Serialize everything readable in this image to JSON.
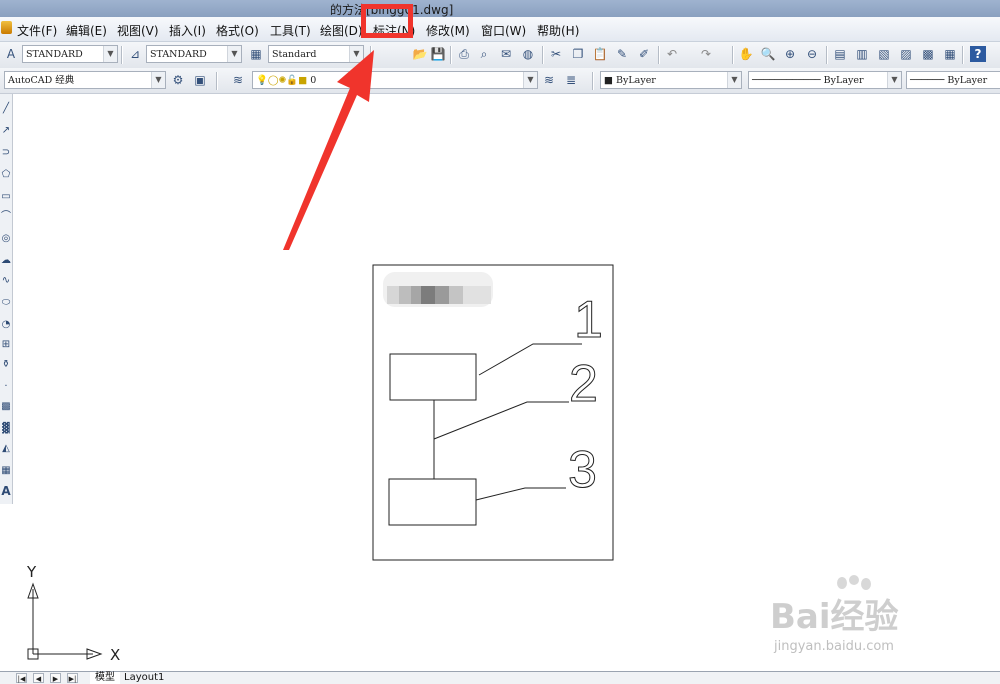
{
  "window": {
    "title": "的方法[blngg01.dwg]"
  },
  "menu": {
    "items": [
      {
        "id": "file",
        "label": "文件(F)"
      },
      {
        "id": "edit",
        "label": "编辑(E)"
      },
      {
        "id": "view",
        "label": "视图(V)"
      },
      {
        "id": "insert",
        "label": "插入(I)"
      },
      {
        "id": "format",
        "label": "格式(O)"
      },
      {
        "id": "tools",
        "label": "工具(T)"
      },
      {
        "id": "draw",
        "label": "绘图(D)"
      },
      {
        "id": "dimension",
        "label": "标注(N)"
      },
      {
        "id": "modify",
        "label": "修改(M)"
      },
      {
        "id": "window",
        "label": "窗口(W)"
      },
      {
        "id": "help",
        "label": "帮助(H)"
      }
    ]
  },
  "toolbar1": {
    "text_style": "STANDARD",
    "dim_style": "STANDARD",
    "table_style": "Standard"
  },
  "toolbar2": {
    "workspace": "AutoCAD 经典",
    "layer": "0",
    "color": "ByLayer",
    "linetype": "ByLayer",
    "lineweight": "ByLayer"
  },
  "drawing": {
    "callout_numbers": [
      "1",
      "2",
      "3"
    ],
    "ucs_x_label": "X",
    "ucs_y_label": "Y"
  },
  "tabs": {
    "model": "模型",
    "layout1": "Layout1"
  },
  "watermark": {
    "brand": "Bai经验",
    "url": "jingyan.baidu.com"
  },
  "colors": {
    "highlight": "#f0342c",
    "titlebar": "#8aa0c0",
    "canvas": "#ffffff"
  }
}
